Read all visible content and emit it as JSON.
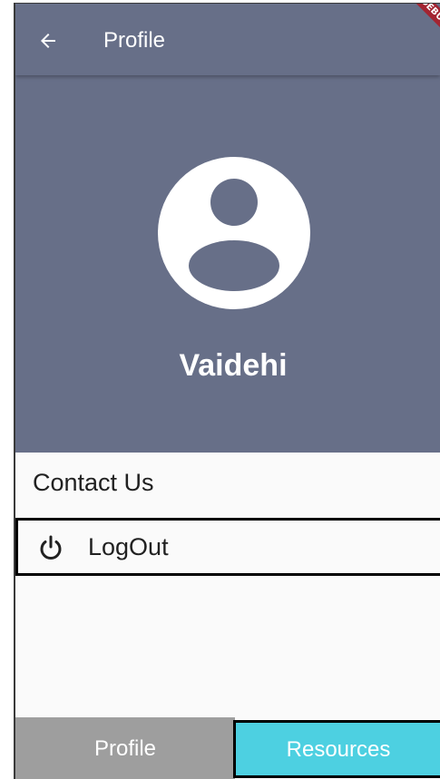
{
  "appbar": {
    "title": "Profile",
    "back_icon": "arrow-back-icon",
    "background_color": "#676f88"
  },
  "debug_banner": {
    "label": "DEBUG",
    "color": "#a32431"
  },
  "profile": {
    "avatar_icon": "account-circle-icon",
    "name": "Vaidehi"
  },
  "menu": {
    "contact_us_label": "Contact Us",
    "logout_label": "LogOut",
    "logout_icon": "power-icon"
  },
  "bottom_nav": {
    "profile_label": "Profile",
    "resources_label": "Resources",
    "profile_color": "#9e9e9e",
    "resources_color": "#4dd0e1"
  }
}
